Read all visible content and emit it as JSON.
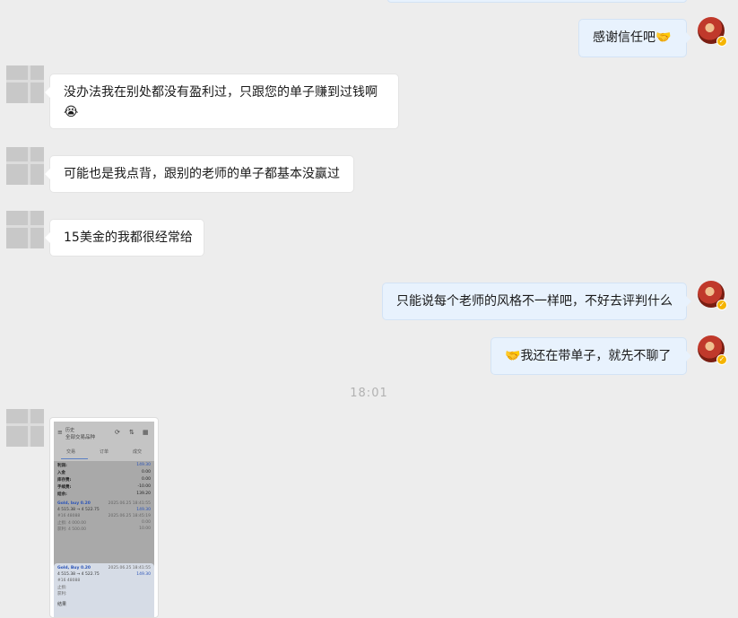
{
  "messages": [
    {
      "side": "out",
      "text": "感谢信任吧",
      "emoji": "handshake"
    },
    {
      "side": "in",
      "text": "没办法我在别处都没有盈利过，只跟您的单子赚到过钱啊",
      "emoji": "crying-face"
    },
    {
      "side": "in",
      "text": "可能也是我点背，跟别的老师的单子都基本没赢过"
    },
    {
      "side": "in",
      "text": "15美金的我都很经常给"
    },
    {
      "side": "out",
      "text": "只能说每个老师的风格不一样吧，不好去评判什么"
    },
    {
      "side": "out",
      "text": "我还在带单子，就先不聊了",
      "emoji": "handshake"
    }
  ],
  "timestamp": "18:01",
  "image_message": {
    "header_small": "历史",
    "header_title": "全部交易品种",
    "tabs": [
      "交易",
      "订单",
      "成交"
    ],
    "summary": [
      {
        "label": "利润:",
        "value": "149.30",
        "accent": true
      },
      {
        "label": "入金",
        "value": "0.00"
      },
      {
        "label": "库存费:",
        "value": "0.00"
      },
      {
        "label": "手续费:",
        "value": "-10.00"
      },
      {
        "label": "结余:",
        "value": "139.20"
      }
    ],
    "trade1": {
      "title": "Gold, buy 0.20",
      "time": "2025.06.25 18:41:55",
      "prices": "4 515.38 → 4 522.75",
      "profit": "149.30",
      "detail": [
        "#16 48088",
        "打开:",
        "2025.06.25 18:45:19",
        "止损:",
        "4 000.00",
        "库存费:",
        "0.00",
        "获利:",
        "4 500.00",
        "手续费:",
        "10.00"
      ]
    },
    "trade2": {
      "title": "Gold, Buy 0.20",
      "time": "2025.06.25 18:41:55",
      "prices": "4 515.38 → 4 522.75",
      "profit": "149.30",
      "footer": "结果"
    }
  },
  "colors": {
    "background": "#ededed",
    "incoming_bubble": "#ffffff",
    "outgoing_bubble": "#e8f2fd",
    "badge": "#f5b400"
  }
}
